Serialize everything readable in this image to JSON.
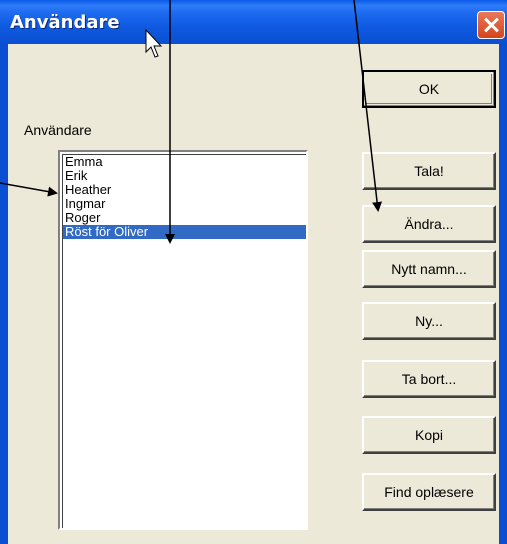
{
  "window": {
    "title": "Användare"
  },
  "label": "Användare",
  "users": [
    "Emma",
    "Erik",
    "Heather",
    "Ingmar",
    "Roger",
    "Röst för Oliver"
  ],
  "selected_index": 5,
  "buttons": {
    "ok": "OK",
    "speak": "Tala!",
    "edit": "Ändra...",
    "rename": "Nytt namn...",
    "new": "Ny...",
    "delete": "Ta bort...",
    "copy": "Kopi",
    "find": "Find oplæsere"
  },
  "colors": {
    "titlebar": "#0a4fd2",
    "selection": "#316ac5",
    "dialog": "#ece9d8"
  },
  "icons": [
    "close-icon",
    "cursor-icon"
  ]
}
